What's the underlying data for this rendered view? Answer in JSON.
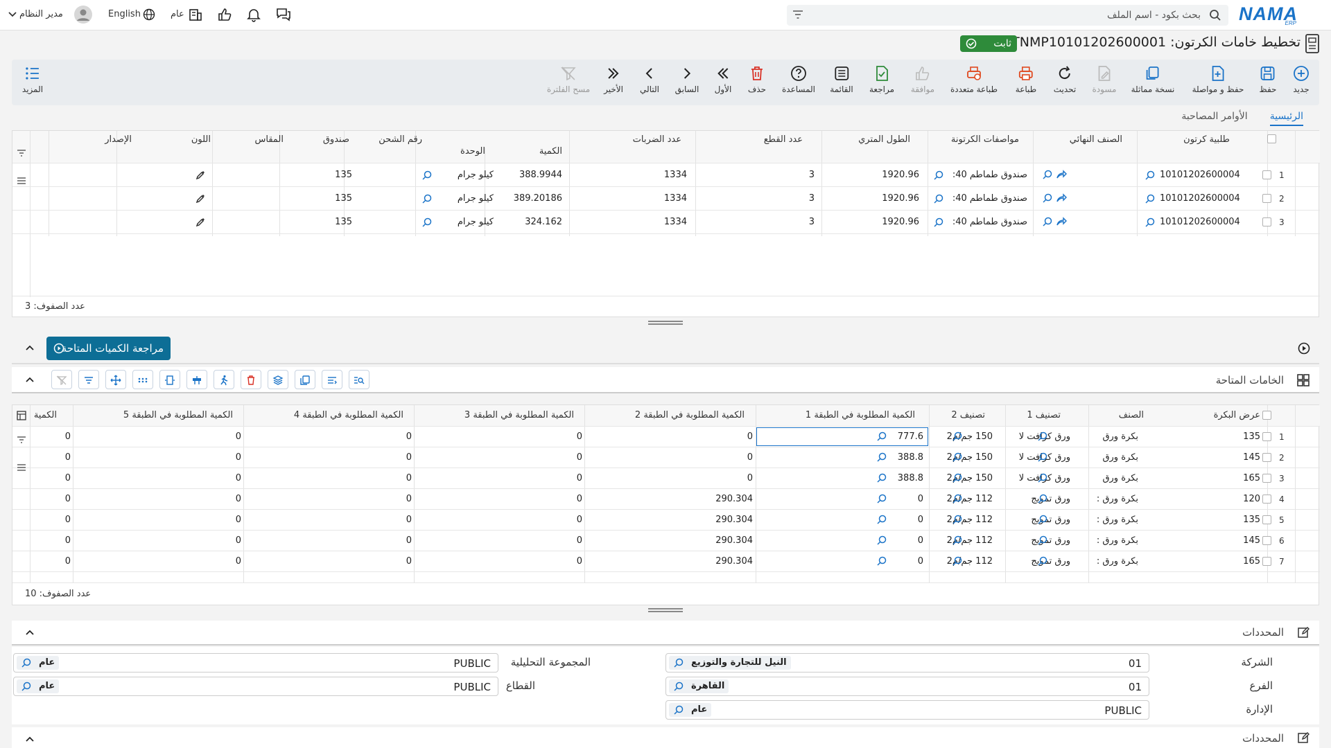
{
  "topbar": {
    "logo": "NAMA",
    "logo_sub": "ERP",
    "search_placeholder": "بحث بكود - اسم الملف",
    "language": "English",
    "user": "مدير النظام",
    "dept": "عام"
  },
  "page": {
    "title": "تخطيط خامات الكرتون: CRTNMP10101202600001",
    "status": "ثابت"
  },
  "toolbar": [
    {
      "label": "جديد",
      "icon": "plus-circle-icon"
    },
    {
      "label": "حفظ",
      "icon": "save-icon"
    },
    {
      "label": "حفظ و مواصلة",
      "icon": "save-continue-icon"
    },
    {
      "label": "نسخة مماثلة",
      "icon": "copy-icon"
    },
    {
      "label": "مسودة",
      "icon": "draft-icon"
    },
    {
      "label": "تحديث",
      "icon": "refresh-icon"
    },
    {
      "label": "طباعة",
      "icon": "print-icon"
    },
    {
      "label": "طباعة متعددة",
      "icon": "multi-print-icon"
    },
    {
      "label": "موافقة",
      "icon": "thumbs-up-icon"
    },
    {
      "label": "مراجعة",
      "icon": "review-icon"
    },
    {
      "label": "القائمة",
      "icon": "list-icon"
    },
    {
      "label": "المساعدة",
      "icon": "help-icon"
    },
    {
      "label": "حذف",
      "icon": "trash-icon"
    },
    {
      "label": "الأول",
      "icon": "first-icon"
    },
    {
      "label": "السابق",
      "icon": "prev-icon"
    },
    {
      "label": "التالي",
      "icon": "next-icon"
    },
    {
      "label": "الأخير",
      "icon": "last-icon"
    },
    {
      "label": "مسح الفلترة",
      "icon": "clear-filter-icon"
    }
  ],
  "more_label": "المزيد",
  "tabs": [
    "الرئيسية",
    "الأوامر المصاحبة"
  ],
  "grid1": {
    "headers": [
      "طلبية كرتون",
      "الصنف النهائي",
      "مواصفات الكرتونة",
      "الطول المتري",
      "عدد القطع",
      "عدد الضربات",
      "الكمية",
      "الوحدة",
      "رقم الشحن",
      "صندوق",
      "المقاس",
      "اللون",
      "الإصدار"
    ],
    "rows": [
      {
        "num": "1",
        "order": "10101202600004",
        "final": "",
        "spec": "صندوق طماطم 40:",
        "length": "1920.96",
        "pieces": "3",
        "hits": "1334",
        "qty": "388.9944",
        "unit": "كيلو جرام",
        "box": "135"
      },
      {
        "num": "2",
        "order": "10101202600004",
        "final": "",
        "spec": "صندوق طماطم 40:",
        "length": "1920.96",
        "pieces": "3",
        "hits": "1334",
        "qty": "389.20186",
        "unit": "كيلو جرام",
        "box": "135"
      },
      {
        "num": "3",
        "order": "10101202600004",
        "final": "",
        "spec": "صندوق طماطم 40:",
        "length": "1920.96",
        "pieces": "3",
        "hits": "1334",
        "qty": "324.162",
        "unit": "كيلو جرام",
        "box": "135"
      }
    ],
    "footer": "عدد الصفوف: 3"
  },
  "review_button": "مراجعة الكميات المتاحة",
  "materials_title": "الخامات المتاحة",
  "grid2": {
    "headers": [
      "عرض البكرة",
      "الصنف",
      "تصنيف 1",
      "تصنيف 2",
      "الكمية المطلوبة في الطبقة 1",
      "الكمية المطلوبة في الطبقة 2",
      "الكمية المطلوبة في الطبقة 3",
      "الكمية المطلوبة في الطبقة 4",
      "الكمية المطلوبة في الطبقة 5",
      "الكمية"
    ],
    "rows": [
      {
        "num": "1",
        "w": "135",
        "item": "بكرة ورق",
        "c1": "ورق كرافت لا",
        "c2": "150 جم/م2",
        "l1": "777.6",
        "l2": "0",
        "l3": "0",
        "l4": "0",
        "l5": "0",
        "q": "0"
      },
      {
        "num": "2",
        "w": "145",
        "item": "بكرة ورق",
        "c1": "ورق كرافت لا",
        "c2": "150 جم/م2",
        "l1": "388.8",
        "l2": "0",
        "l3": "0",
        "l4": "0",
        "l5": "0",
        "q": "0"
      },
      {
        "num": "3",
        "w": "165",
        "item": "بكرة ورق",
        "c1": "ورق كرافت لا",
        "c2": "150 جم/م2",
        "l1": "388.8",
        "l2": "0",
        "l3": "0",
        "l4": "0",
        "l5": "0",
        "q": "0"
      },
      {
        "num": "4",
        "w": "120",
        "item": "بكرة ورق :",
        "c1": "ورق تمويج",
        "c2": "112 جم/م2",
        "l1": "0",
        "l2": "290.304",
        "l3": "0",
        "l4": "0",
        "l5": "0",
        "q": "0"
      },
      {
        "num": "5",
        "w": "135",
        "item": "بكرة ورق :",
        "c1": "ورق تمويج",
        "c2": "112 جم/م2",
        "l1": "0",
        "l2": "290.304",
        "l3": "0",
        "l4": "0",
        "l5": "0",
        "q": "0"
      },
      {
        "num": "6",
        "w": "145",
        "item": "بكرة ورق :",
        "c1": "ورق تمويج",
        "c2": "112 جم/م2",
        "l1": "0",
        "l2": "290.304",
        "l3": "0",
        "l4": "0",
        "l5": "0",
        "q": "0"
      },
      {
        "num": "7",
        "w": "165",
        "item": "بكرة ورق :",
        "c1": "ورق تمويج",
        "c2": "112 جم/م2",
        "l1": "0",
        "l2": "290.304",
        "l3": "0",
        "l4": "0",
        "l5": "0",
        "q": "0"
      }
    ],
    "footer": "عدد الصفوف: 10"
  },
  "identifiers_title": "المحددات",
  "fields": {
    "company_label": "الشركة",
    "company_code": "01",
    "company_name": "النيل للتجارة والتوزيع",
    "branch_label": "الفرع",
    "branch_code": "01",
    "branch_name": "القاهرة",
    "admin_label": "الإدارة",
    "admin_code": "PUBLIC",
    "admin_name": "عام",
    "analytic_label": "المجموعة التحليلية",
    "analytic_code": "PUBLIC",
    "analytic_name": "عام",
    "sector_label": "القطاع",
    "sector_code": "PUBLIC",
    "sector_name": "عام"
  },
  "colors": {
    "accent": "#1a73c8",
    "badge": "#2e8b3a",
    "review": "#0d6e96"
  }
}
